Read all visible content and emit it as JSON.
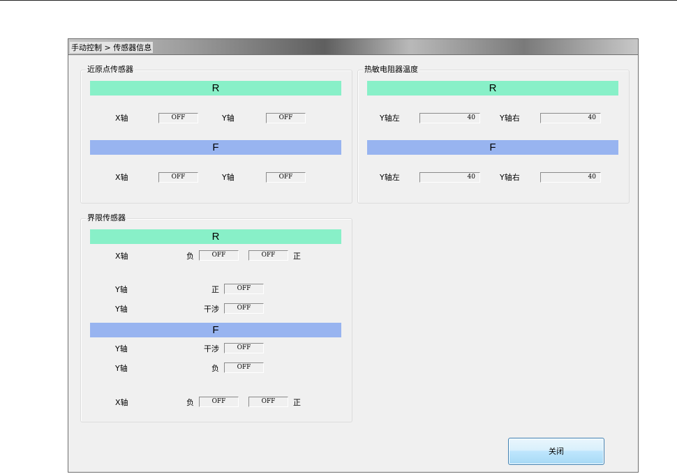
{
  "window": {
    "title": "手动控制 > 传感器信息"
  },
  "near_origin": {
    "title": "近原点传感器",
    "r": {
      "header": "R",
      "x_label": "X轴",
      "x_value": "OFF",
      "y_label": "Y轴",
      "y_value": "OFF"
    },
    "f": {
      "header": "F",
      "x_label": "X轴",
      "x_value": "OFF",
      "y_label": "Y轴",
      "y_value": "OFF"
    }
  },
  "thermistor": {
    "title": "热敏电阻器温度",
    "r": {
      "header": "R",
      "left_label": "Y轴左",
      "left_value": "40",
      "right_label": "Y轴右",
      "right_value": "40"
    },
    "f": {
      "header": "F",
      "left_label": "Y轴左",
      "left_value": "40",
      "right_label": "Y轴右",
      "right_value": "40"
    }
  },
  "limit": {
    "title": "界限传感器",
    "r": {
      "header": "R",
      "x_label": "X轴",
      "x_neg_label": "负",
      "x_neg_value": "OFF",
      "x_pos_value": "OFF",
      "x_pos_label": "正",
      "y1_label": "Y轴",
      "y1_state_label": "正",
      "y1_value": "OFF",
      "y2_label": "Y轴",
      "y2_state_label": "干涉",
      "y2_value": "OFF"
    },
    "f": {
      "header": "F",
      "y1_label": "Y轴",
      "y1_state_label": "干涉",
      "y1_value": "OFF",
      "y2_label": "Y轴",
      "y2_state_label": "负",
      "y2_value": "OFF",
      "x_label": "X轴",
      "x_neg_label": "负",
      "x_neg_value": "OFF",
      "x_pos_value": "OFF",
      "x_pos_label": "正"
    }
  },
  "buttons": {
    "close": "关闭"
  },
  "colors": {
    "r_bar": "#88f0c8",
    "f_bar": "#98b4f0"
  }
}
